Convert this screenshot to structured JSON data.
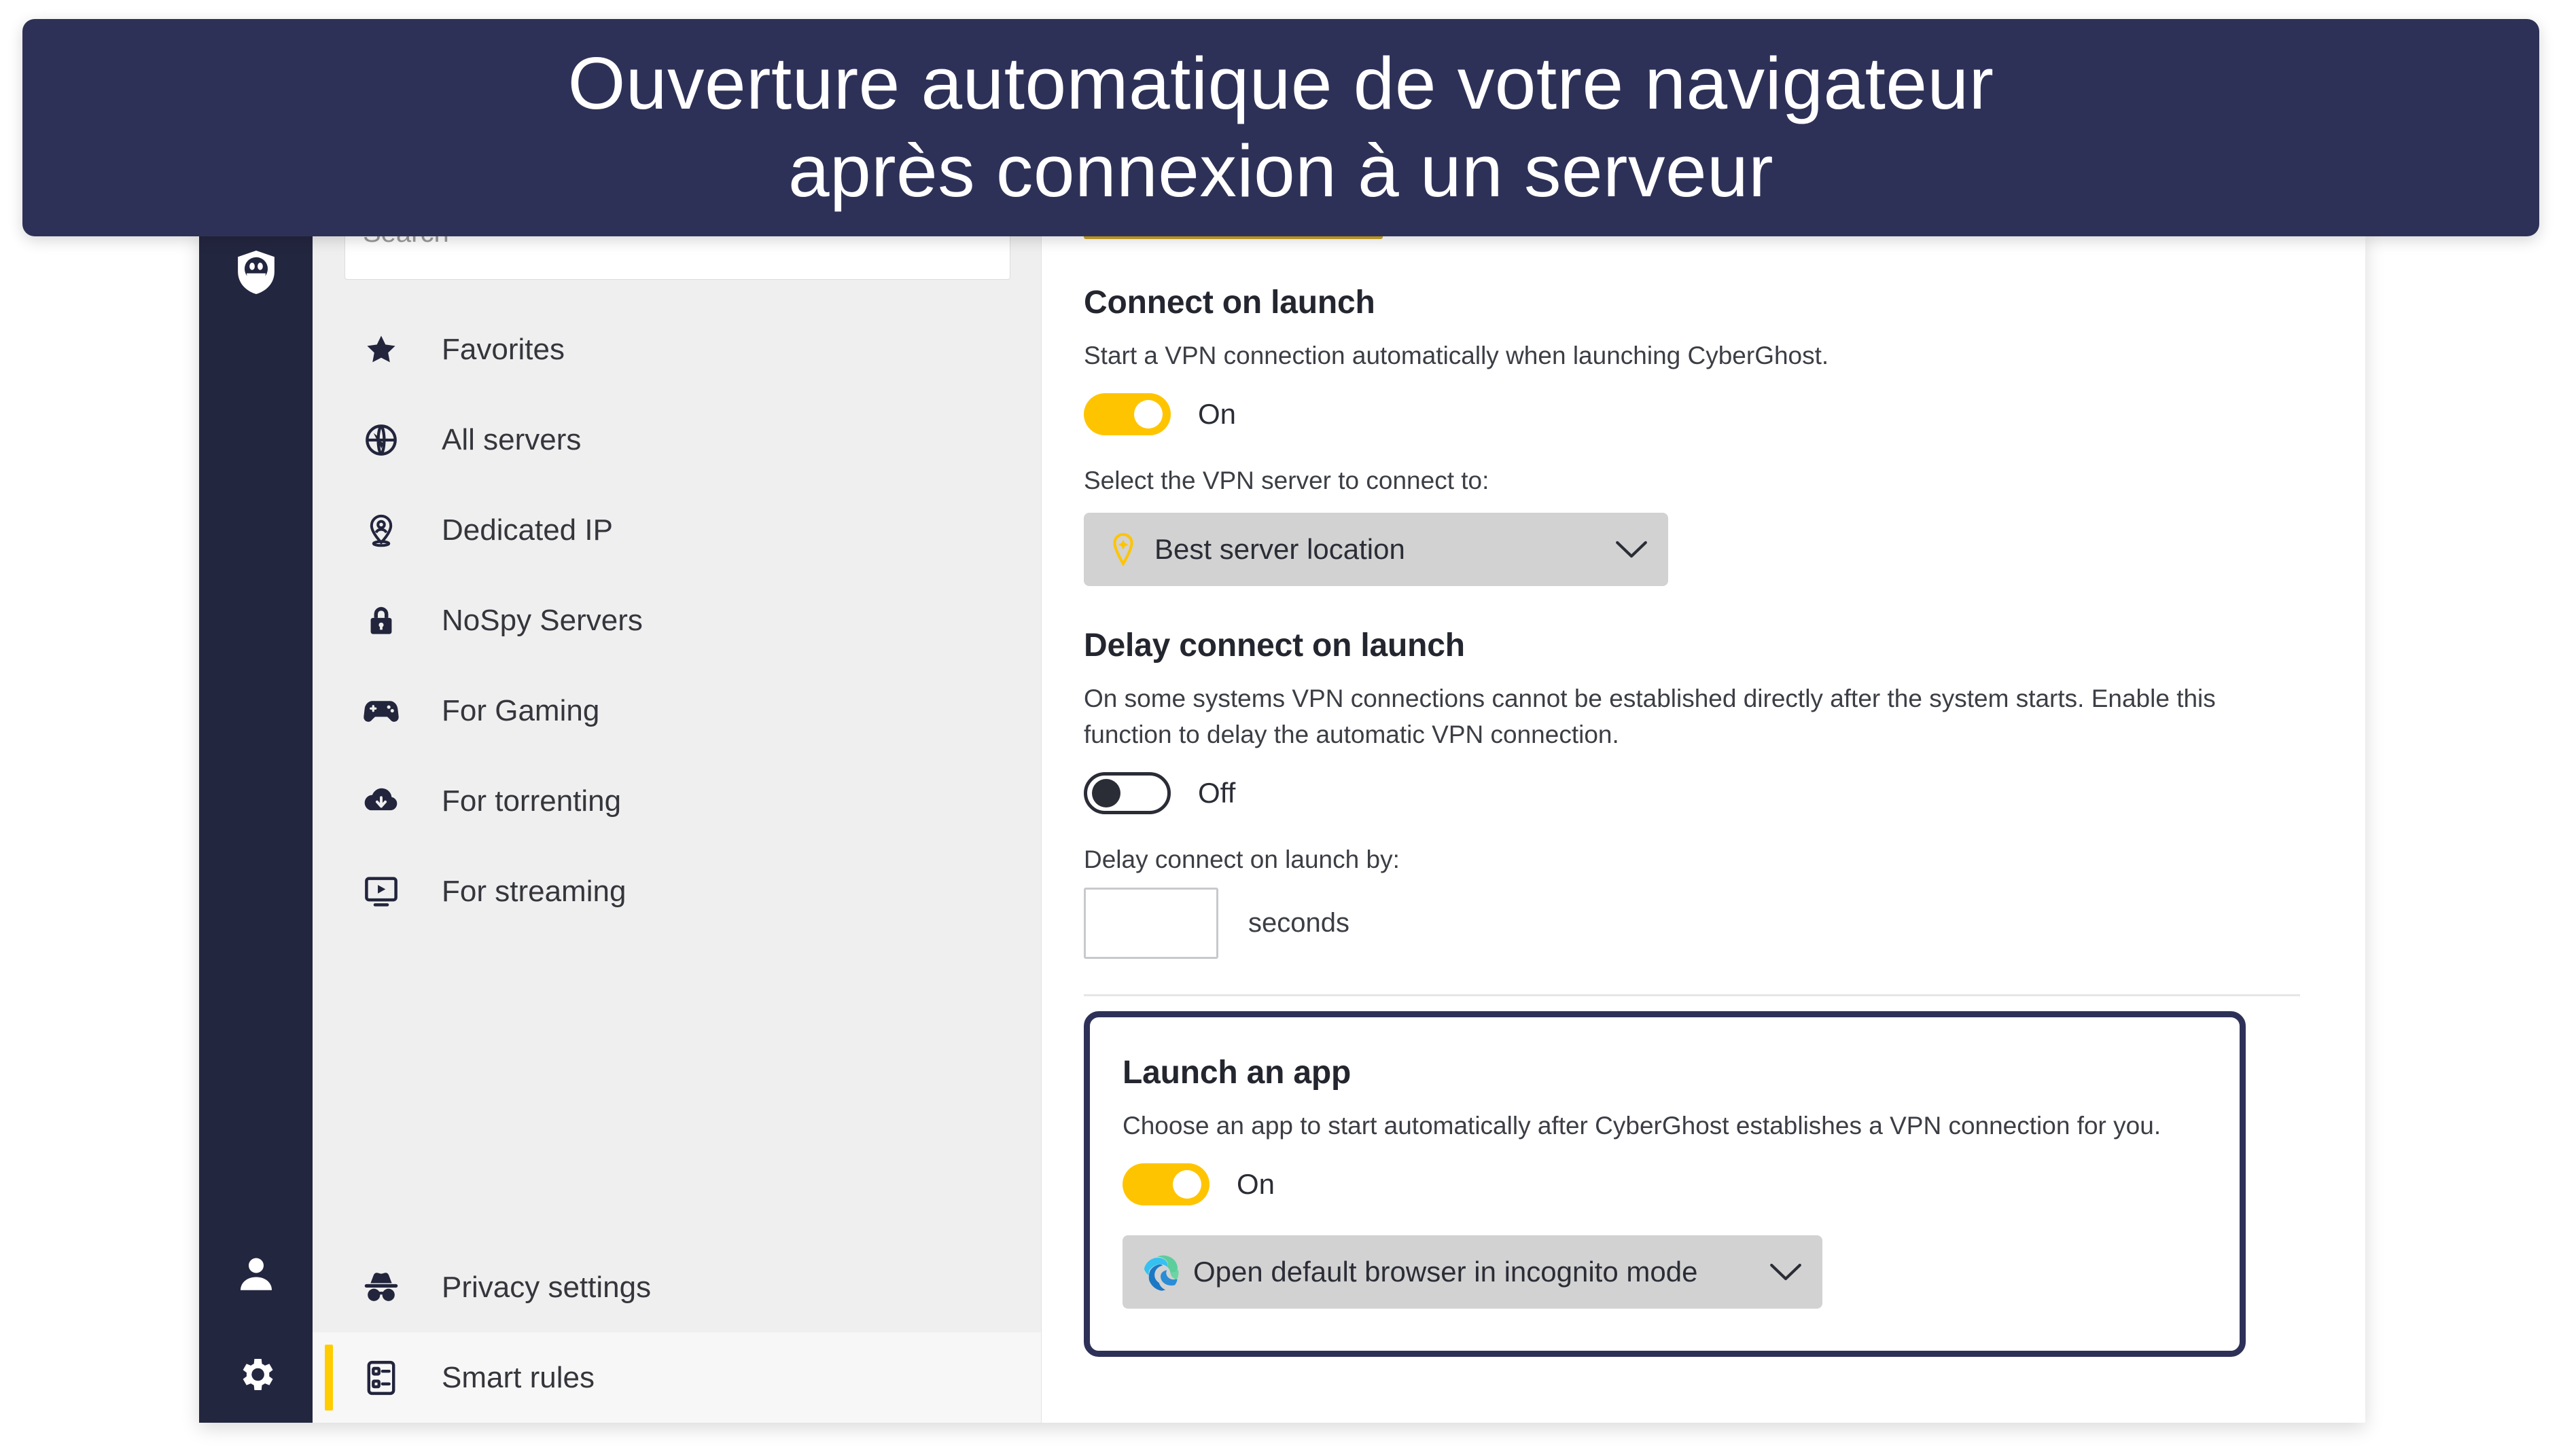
{
  "banner": {
    "line1": "Ouverture automatique de votre navigateur",
    "line2": "après connexion à un serveur",
    "background_color": "#2E3157",
    "text_color": "#FFFFFF"
  },
  "colors": {
    "accent_yellow": "#FFC400",
    "active_bar_yellow": "#FFCC00",
    "tab_underline": "#C9A425",
    "rail_dark": "#23263F",
    "panel_gray": "#EFEFEF",
    "dropdown_gray": "#D2D2D2",
    "highlight_border": "#2E3157"
  },
  "rail": {
    "logo_icon": "cyberghost-shield-icon",
    "bottom_icons": [
      {
        "icon": "user-account-icon",
        "name": "account"
      },
      {
        "icon": "gear-settings-icon",
        "name": "settings"
      }
    ]
  },
  "server_list": {
    "search": {
      "placeholder": "Search",
      "value": "",
      "icon": "search-icon"
    },
    "items": [
      {
        "label": "Favorites",
        "icon": "star-icon",
        "active": false
      },
      {
        "label": "All servers",
        "icon": "globe-icon",
        "active": false
      },
      {
        "label": "Dedicated IP",
        "icon": "location-pin-person-icon",
        "active": false
      },
      {
        "label": "NoSpy Servers",
        "icon": "lock-icon",
        "active": false
      },
      {
        "label": "For Gaming",
        "icon": "gamepad-icon",
        "active": false
      },
      {
        "label": "For torrenting",
        "icon": "cloud-download-icon",
        "active": false
      },
      {
        "label": "For streaming",
        "icon": "monitor-play-icon",
        "active": false
      }
    ],
    "bottom_items": [
      {
        "label": "Privacy settings",
        "icon": "incognito-hat-icon",
        "active": false
      },
      {
        "label": "Smart rules",
        "icon": "smart-rules-icon",
        "active": true
      }
    ]
  },
  "settings": {
    "connect_on_launch": {
      "title": "Connect on launch",
      "description": "Start a VPN connection automatically when launching CyberGhost.",
      "toggle_state": "On",
      "toggle_on": true,
      "server_label": "Select the VPN server to connect to:",
      "server_value": "Best server location",
      "server_icon": "best-location-pin-icon",
      "chevron_icon": "chevron-down-icon"
    },
    "delay_connect": {
      "title": "Delay connect on launch",
      "description": "On some systems VPN connections cannot be established directly after the system starts. Enable this function to delay the automatic VPN connection.",
      "toggle_state": "Off",
      "toggle_on": false,
      "delay_label": "Delay connect on launch by:",
      "delay_value": "",
      "delay_unit": "seconds"
    },
    "launch_an_app": {
      "title": "Launch an app",
      "description": "Choose an app to start automatically after CyberGhost establishes a VPN connection for you.",
      "toggle_state": "On",
      "toggle_on": true,
      "app_value": "Open default browser in incognito mode",
      "app_icon": "microsoft-edge-icon",
      "chevron_icon": "chevron-down-icon",
      "highlighted": true
    }
  }
}
